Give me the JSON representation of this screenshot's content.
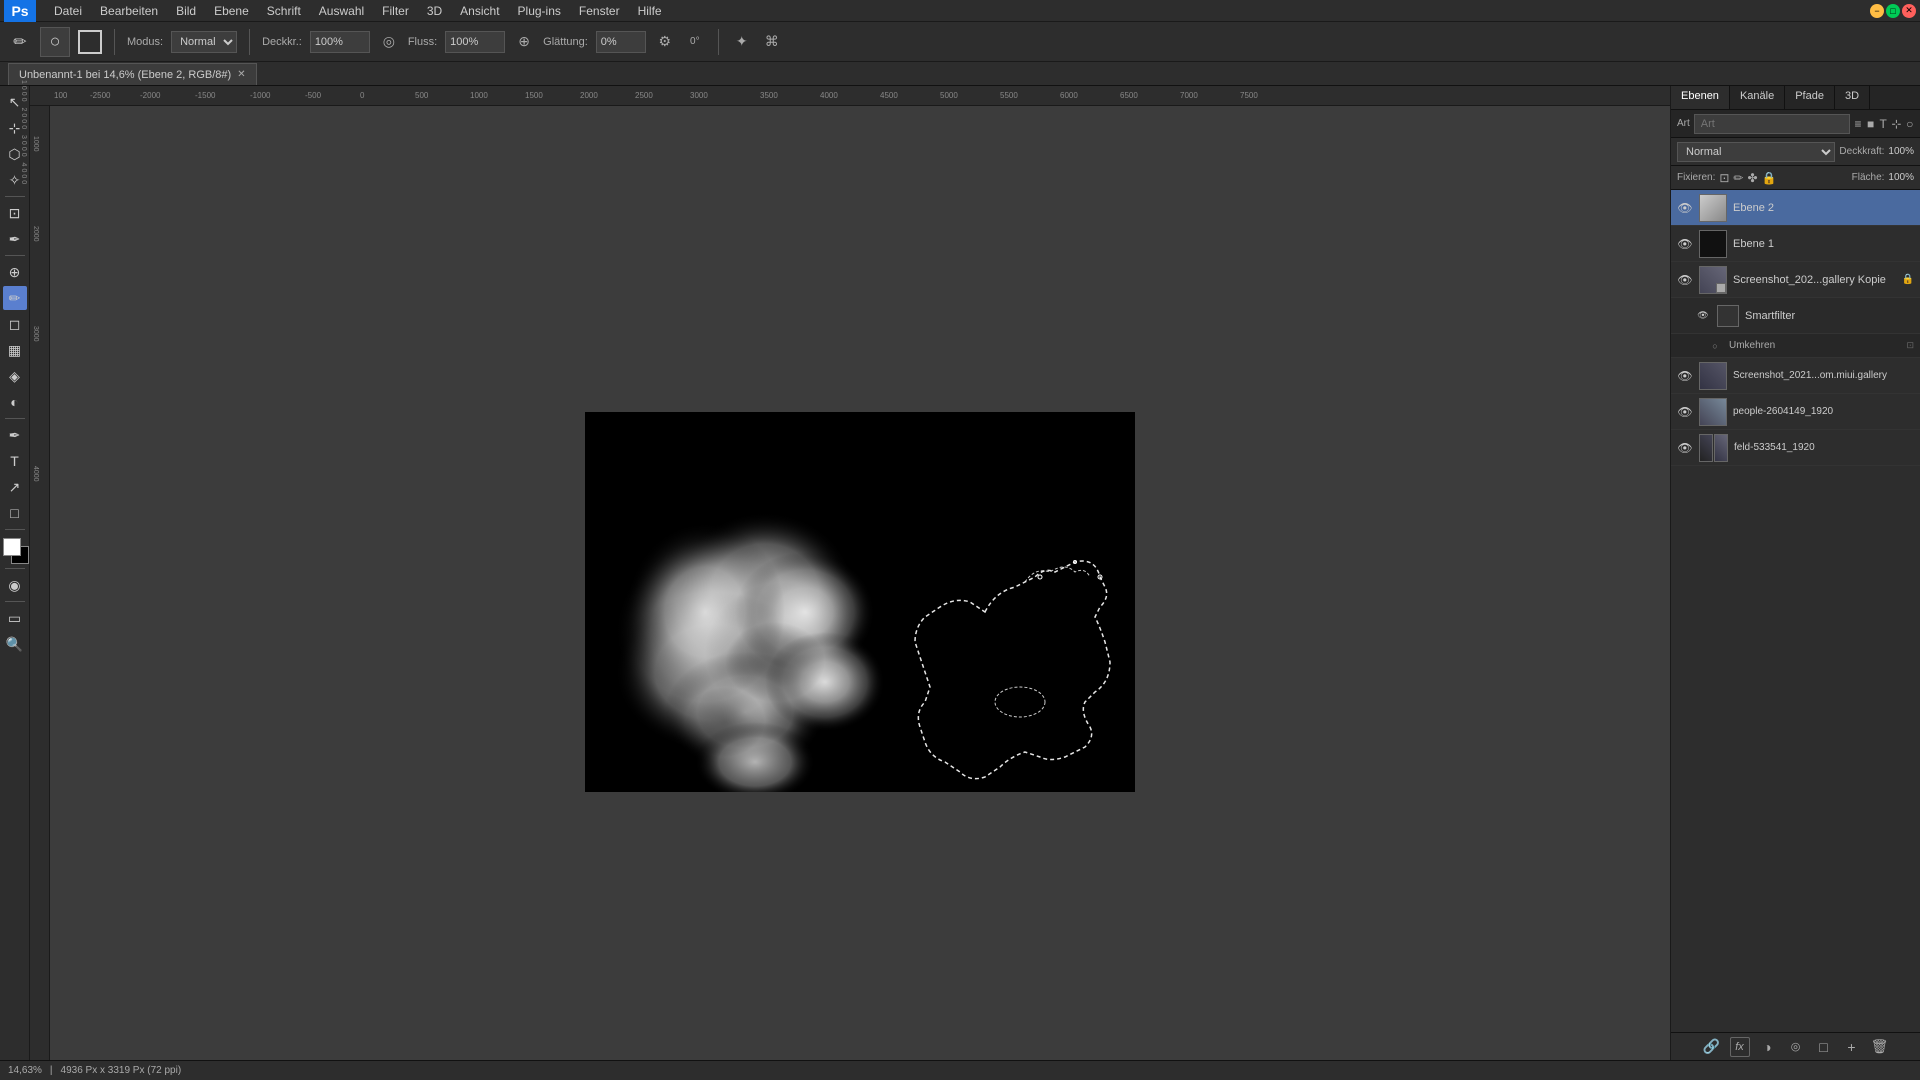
{
  "app": {
    "name": "Photoshop",
    "logo": "Ps"
  },
  "menu": {
    "items": [
      "Datei",
      "Bearbeiten",
      "Bild",
      "Ebene",
      "Schrift",
      "Auswahl",
      "Filter",
      "3D",
      "Ansicht",
      "Plug-ins",
      "Fenster",
      "Hilfe"
    ]
  },
  "window": {
    "minimize": "−",
    "maximize": "□",
    "close": "✕"
  },
  "options_bar": {
    "tool_icon": "✏",
    "modus_label": "Modus:",
    "modus_value": "Normal",
    "deckkraft_label": "Deckkr.:",
    "deckkraft_value": "100%",
    "fluss_label": "Fluss:",
    "fluss_value": "100%",
    "glattung_label": "Glättung:",
    "glattung_value": "0%"
  },
  "tab": {
    "title": "Unbenannt-1 bei 14,6% (Ebene 2, RGB/8#)",
    "close": "✕"
  },
  "tools": [
    {
      "icon": "↖",
      "name": "move-tool"
    },
    {
      "icon": "⊹",
      "name": "selection-tool"
    },
    {
      "icon": "⬡",
      "name": "lasso-tool"
    },
    {
      "icon": "⊙",
      "name": "magic-wand-tool"
    },
    {
      "icon": "✂",
      "name": "crop-tool"
    },
    {
      "icon": "⊡",
      "name": "eyedropper-tool"
    },
    {
      "icon": "☰",
      "name": "healing-tool"
    },
    {
      "icon": "✏",
      "name": "brush-tool"
    },
    {
      "icon": "🗑",
      "name": "eraser-tool"
    },
    {
      "icon": "▦",
      "name": "gradient-tool"
    },
    {
      "icon": "⬡",
      "name": "pen-tool"
    },
    {
      "icon": "T",
      "name": "text-tool"
    },
    {
      "icon": "↗",
      "name": "path-selection-tool"
    },
    {
      "icon": "□",
      "name": "shape-tool"
    },
    {
      "icon": "🔍",
      "name": "zoom-tool"
    }
  ],
  "ruler": {
    "h_marks": [
      "-100",
      "-2500",
      "-2000",
      "-1500",
      "-1000",
      "-500",
      "0",
      "500",
      "1000",
      "1500",
      "2000",
      "2500",
      "3000",
      "3500",
      "4000",
      "4500",
      "5000",
      "5500",
      "6000",
      "6500",
      "7000",
      "7500"
    ],
    "v_marks": [
      "1000",
      "2000",
      "3000",
      "4000"
    ]
  },
  "panel": {
    "tabs": [
      "Ebenen",
      "Kanäle",
      "Pfade",
      "3D"
    ],
    "active_tab": "Ebenen"
  },
  "layers_panel": {
    "search_placeholder": "Art",
    "mode_label": "Normal",
    "opacity_label": "Deckkraft:",
    "opacity_value": "100%",
    "fill_label": "Fläche:",
    "fill_value": "100%",
    "fixieren_label": "Fixieren:",
    "layers": [
      {
        "name": "Ebene 2",
        "visible": true,
        "active": true,
        "thumb_color": "#d0d0d0",
        "locked": false
      },
      {
        "name": "Ebene 1",
        "visible": true,
        "active": false,
        "thumb_color": "#222",
        "locked": false
      },
      {
        "name": "Screenshot_202...gallery Kopie",
        "visible": true,
        "active": false,
        "thumb_color": "#556",
        "locked": true,
        "has_sub": true
      },
      {
        "name": "Smartfilter",
        "visible": true,
        "active": false,
        "thumb_color": "#333",
        "locked": false,
        "sublevel": true
      },
      {
        "name": "Umkehren",
        "visible": true,
        "active": false,
        "thumb_color": "",
        "locked": false,
        "sublevel2": true
      },
      {
        "name": "Screenshot_2021...om.miui.gallery",
        "visible": true,
        "active": false,
        "thumb_color": "#445",
        "locked": false
      },
      {
        "name": "people-2604149_1920",
        "visible": true,
        "active": false,
        "thumb_color": "#667",
        "locked": false
      },
      {
        "name": "feld-533541_1920",
        "visible": true,
        "active": false,
        "thumb_color": "#334",
        "locked": false
      }
    ],
    "bottom_icons": [
      "fx",
      "□",
      "◉",
      "▦",
      "🗑"
    ]
  },
  "status_bar": {
    "zoom": "14,63%",
    "doc_size": "4936 Px x 3319 Px (72 ppi)"
  }
}
